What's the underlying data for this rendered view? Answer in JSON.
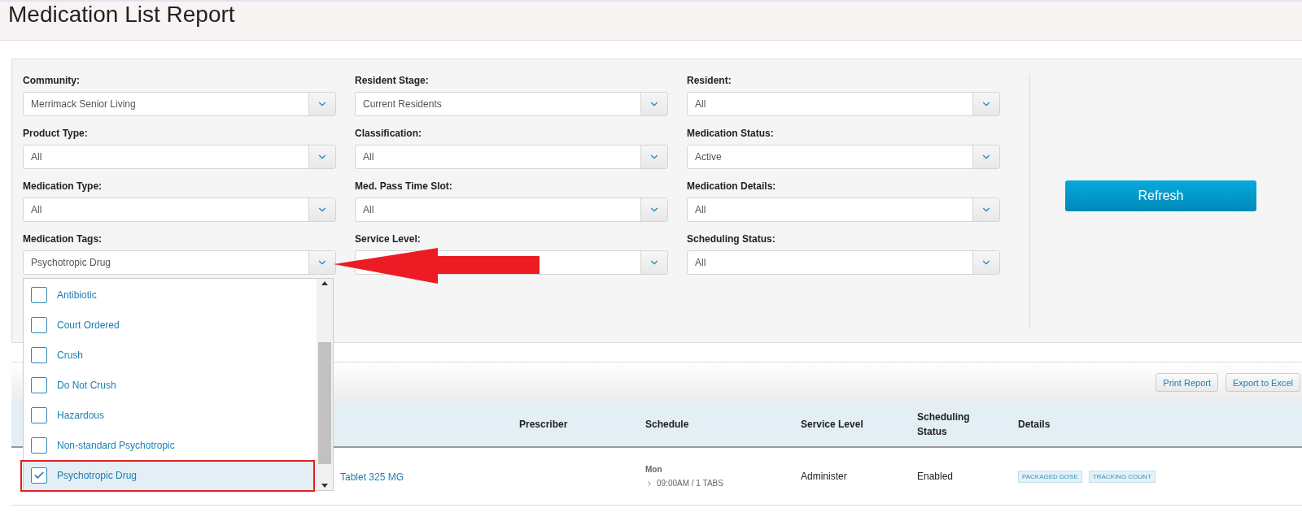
{
  "title": "Medication List Report",
  "filters": [
    {
      "label": "Community:",
      "value": "Merrimack Senior Living"
    },
    {
      "label": "Resident Stage:",
      "value": "Current Residents"
    },
    {
      "label": "Resident:",
      "value": "All"
    },
    {
      "label": "Product Type:",
      "value": "All"
    },
    {
      "label": "Classification:",
      "value": "All"
    },
    {
      "label": "Medication Status:",
      "value": "Active"
    },
    {
      "label": "Medication Type:",
      "value": "All"
    },
    {
      "label": "Med. Pass Time Slot:",
      "value": "All"
    },
    {
      "label": "Medication Details:",
      "value": "All"
    },
    {
      "label": "Medication Tags:",
      "value": "Psychotropic Drug"
    },
    {
      "label": "Service Level:"
    },
    {
      "label": "Scheduling Status:",
      "value": "All"
    }
  ],
  "refresh_button": "Refresh",
  "tag_options": [
    {
      "label": "Antibiotic",
      "checked": false,
      "selected": false
    },
    {
      "label": "Court Ordered",
      "checked": false,
      "selected": false
    },
    {
      "label": "Crush",
      "checked": false,
      "selected": false
    },
    {
      "label": "Do Not Crush",
      "checked": false,
      "selected": false
    },
    {
      "label": "Hazardous",
      "checked": false,
      "selected": false
    },
    {
      "label": "Non-standard Psychotropic",
      "checked": false,
      "selected": false
    },
    {
      "label": "Psychotropic Drug",
      "checked": true,
      "selected": true
    }
  ],
  "toolbar_buttons": [
    "Print Report",
    "Export to Excel"
  ],
  "table": {
    "columns": [
      "Prescriber",
      "Schedule",
      "Service Level",
      "Scheduling Status",
      "Details"
    ],
    "rows": [
      {
        "medication": "Tablet 325 MG",
        "schedule_day": "Mon",
        "schedule_time": "09:00AM / 1 TABS",
        "service_level": "Administer",
        "scheduling_status": "Enabled",
        "details": [
          "PACKAGED DOSE",
          "TRACKING COUNT"
        ]
      }
    ]
  }
}
